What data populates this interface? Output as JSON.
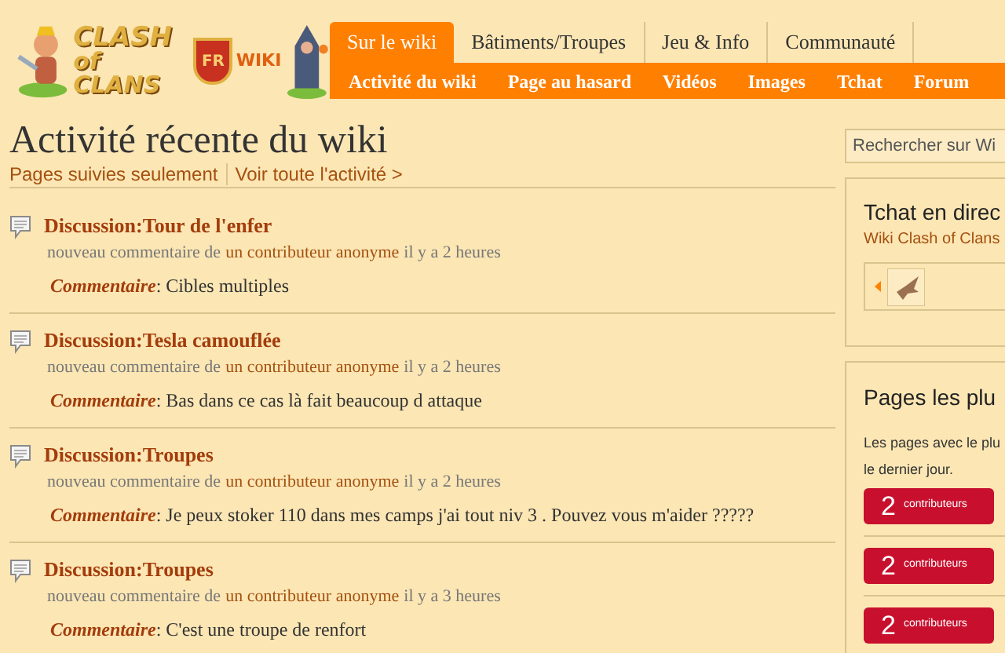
{
  "logo": {
    "line1": "CLASH",
    "line2": "of CLANS",
    "badge": "FR",
    "suffix": "WIKI"
  },
  "tabs": [
    {
      "label": "Sur le wiki",
      "selected": true
    },
    {
      "label": "Bâtiments/Troupes",
      "selected": false
    },
    {
      "label": "Jeu & Info",
      "selected": false
    },
    {
      "label": "Communauté",
      "selected": false
    }
  ],
  "subnav": [
    "Activité du wiki",
    "Page au hasard",
    "Vidéos",
    "Images",
    "Tchat",
    "Forum"
  ],
  "page_title": "Activité récente du wiki",
  "filters": [
    {
      "label": "Pages suivies seulement"
    },
    {
      "label": "Voir toute l'activité >"
    }
  ],
  "activity": [
    {
      "title": "Discussion:Tour de l'enfer",
      "action": "nouveau commentaire de",
      "user": "un contributeur anonyme",
      "time": "il y a 2 heures",
      "label": "Commentaire",
      "text": ": Cibles multiples"
    },
    {
      "title": "Discussion:Tesla camouflée",
      "action": "nouveau commentaire de",
      "user": "un contributeur anonyme",
      "time": "il y a 2 heures",
      "label": "Commentaire",
      "text": ": Bas dans ce cas là fait beaucoup d attaque"
    },
    {
      "title": "Discussion:Troupes",
      "action": "nouveau commentaire de",
      "user": "un contributeur anonyme",
      "time": "il y a 2 heures",
      "label": "Commentaire",
      "text": ": Je peux stoker 110 dans mes camps j'ai tout niv 3 . Pouvez vous m'aider ?????"
    },
    {
      "title": "Discussion:Troupes",
      "action": "nouveau commentaire de",
      "user": "un contributeur anonyme",
      "time": "il y a 3 heures",
      "label": "Commentaire",
      "text": ": C'est une troupe de renfort"
    }
  ],
  "sidebar": {
    "search": {
      "placeholder": "Rechercher sur Wi"
    },
    "chat": {
      "title": "Tchat en direc",
      "subtitle": "Wiki Clash of Clans"
    },
    "popular": {
      "title": "Pages les plu",
      "description": "Les pages avec le plu le dernier jour.",
      "items": [
        {
          "count": "2",
          "unit": "contributeurs"
        },
        {
          "count": "2",
          "unit": "contributeurs"
        },
        {
          "count": "2",
          "unit": "contributeurs"
        }
      ]
    }
  }
}
